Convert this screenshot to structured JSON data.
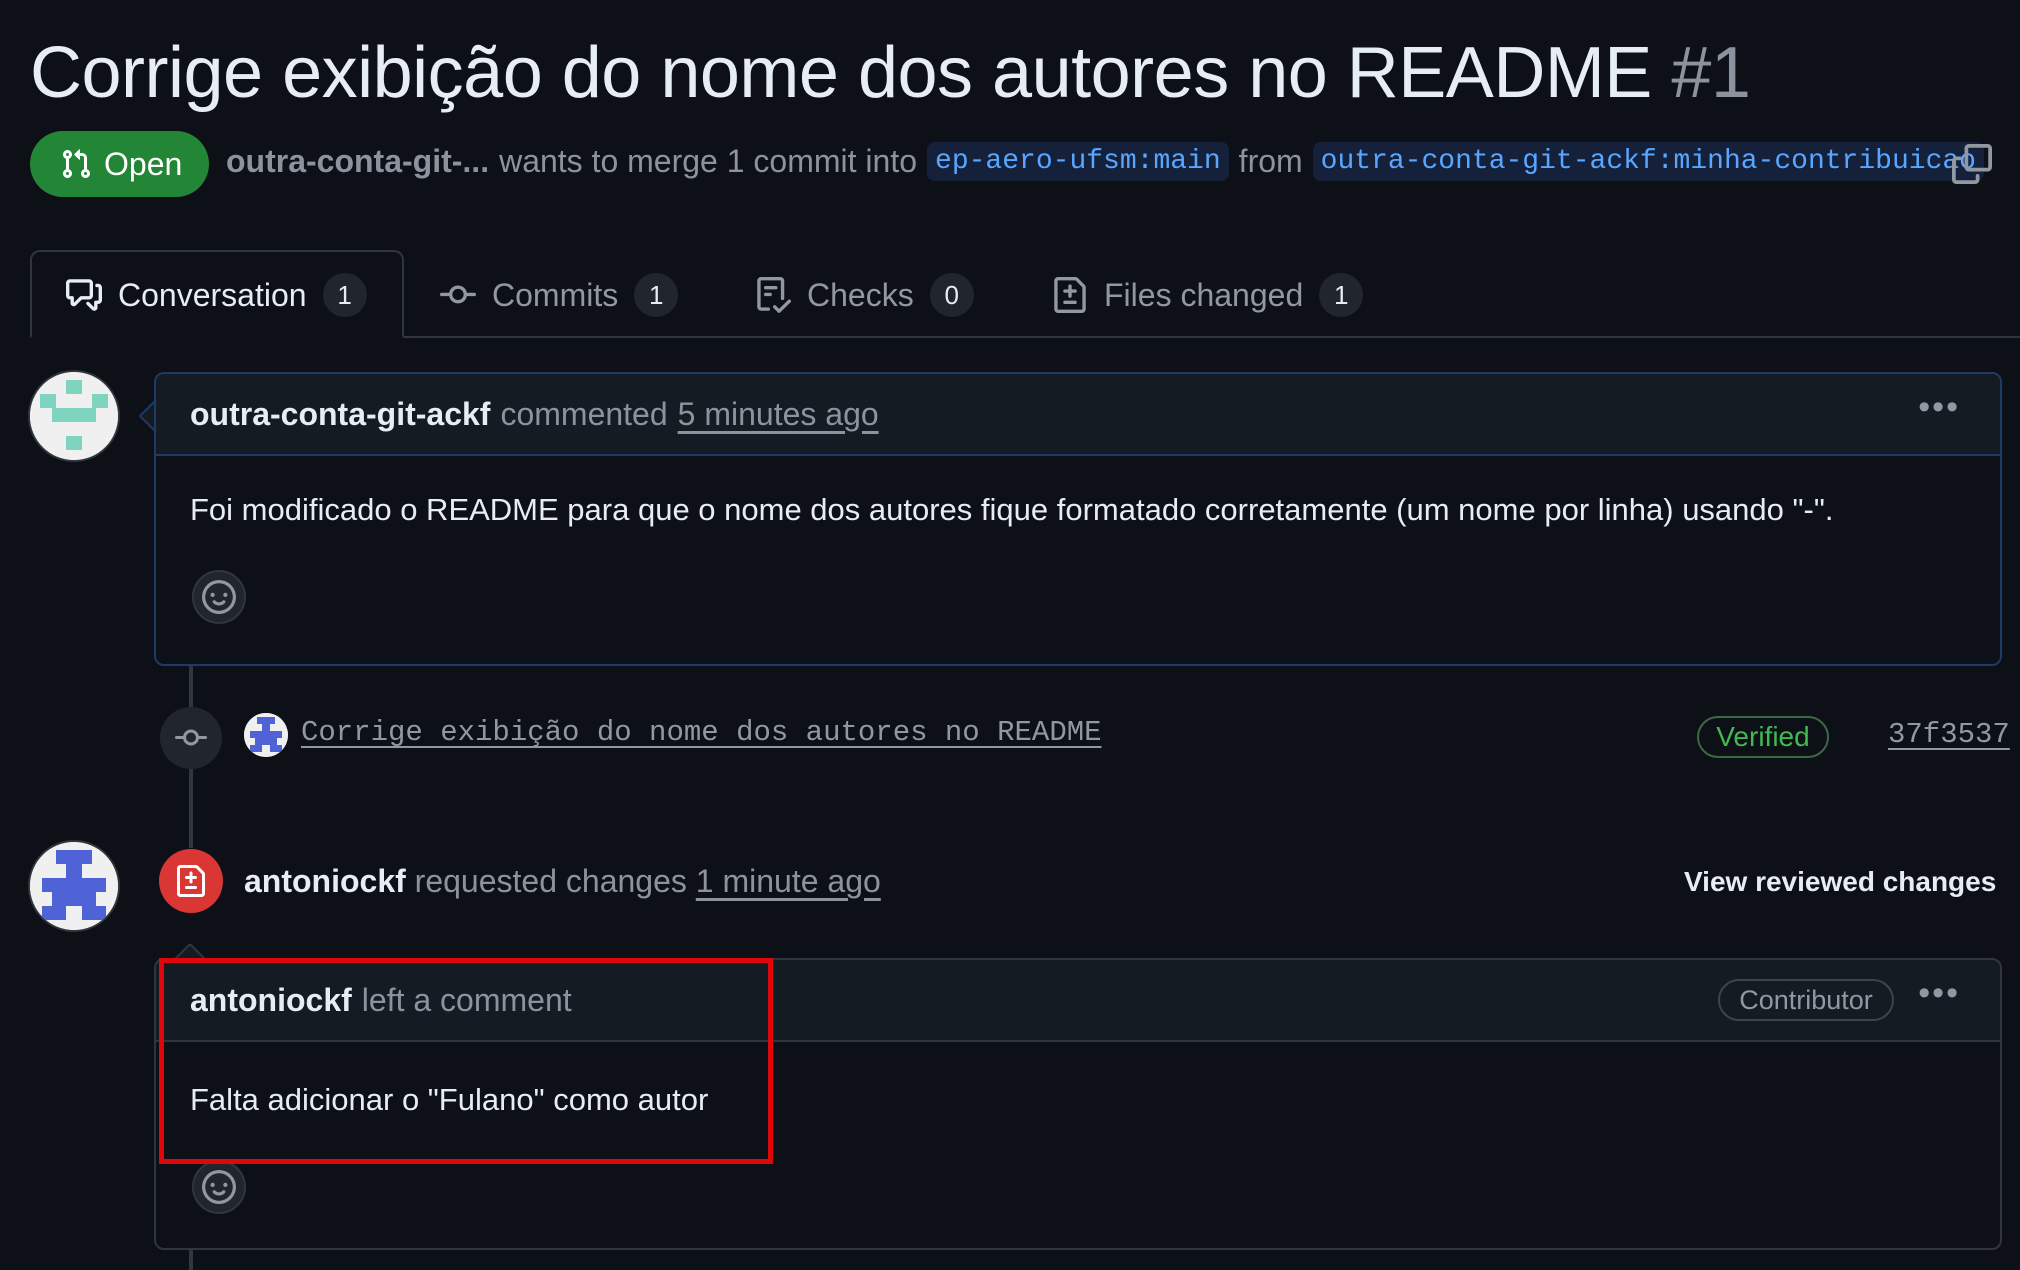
{
  "pr": {
    "title": "Corrige exibição do nome dos autores no README",
    "number": "#1",
    "state_label": "Open",
    "author_short": "outra-conta-git-...",
    "merge_text": "wants to merge 1 commit into",
    "base_branch": "ep-aero-ufsm:main",
    "from_text": "from",
    "head_branch": "outra-conta-git-ackf:minha-contribuicao"
  },
  "tabs": [
    {
      "label": "Conversation",
      "count": "1",
      "icon": "comment-discussion-icon"
    },
    {
      "label": "Commits",
      "count": "1",
      "icon": "git-commit-icon"
    },
    {
      "label": "Checks",
      "count": "0",
      "icon": "checklist-icon"
    },
    {
      "label": "Files changed",
      "count": "1",
      "icon": "file-diff-icon"
    }
  ],
  "first_comment": {
    "author": "outra-conta-git-ackf",
    "action": "commented",
    "time": "5 minutes ago",
    "body": "Foi modificado o README para que o nome dos autores fique formatado corretamente (um nome por linha) usando \"-\"."
  },
  "commit": {
    "message": "Corrige exibição do nome dos autores no README",
    "verified_label": "Verified",
    "sha": "37f3537"
  },
  "review": {
    "author": "antoniockf",
    "action": "requested changes",
    "time": "1 minute ago",
    "view_label": "View reviewed changes"
  },
  "review_comment": {
    "author": "antoniockf",
    "action": "left a comment",
    "badge": "Contributor",
    "body": "Falta adicionar o \"Fulano\" como autor"
  },
  "colors": {
    "background": "#0d1117",
    "open_green": "#238636",
    "link_blue": "#58a6ff",
    "verified_green": "#3fb950",
    "changes_red": "#da3633",
    "highlight_red": "#e0070b"
  }
}
